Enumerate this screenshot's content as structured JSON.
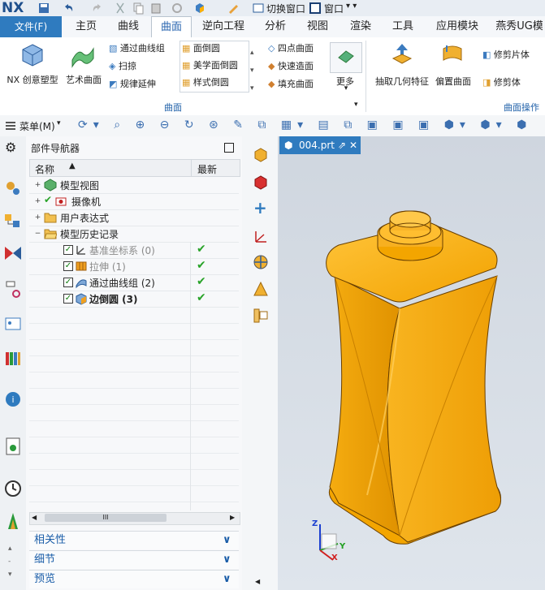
{
  "app": {
    "logo": "NX",
    "switch_window": "切换窗口",
    "window_menu": "窗口"
  },
  "menu": {
    "file": "文件(F)",
    "tabs": [
      "主页",
      "曲线",
      "曲面",
      "逆向工程",
      "分析",
      "视图",
      "渲染",
      "工具",
      "应用模块",
      "燕秀UG模"
    ],
    "active": "曲面"
  },
  "ribbon": {
    "big": [
      "NX 创意塑型",
      "艺术曲面"
    ],
    "col1": [
      "通过曲线组",
      "扫掠",
      "规律延伸"
    ],
    "col2": [
      "面倒圆",
      "美学面倒圆",
      "样式倒圆"
    ],
    "col3": [
      "四点曲面",
      "快速造面",
      "填充曲面"
    ],
    "more": "更多",
    "group1_label": "曲面",
    "extract": "抽取几何特征",
    "offset": "偏置曲面",
    "trim_sheet": "修剪片体",
    "trim_body": "修剪体",
    "group2_label": "曲面操作"
  },
  "toolbar": {
    "menu_label": "菜单(M)"
  },
  "navigator": {
    "title": "部件导航器",
    "col_name": "名称",
    "col_latest": "最新",
    "rows": [
      {
        "label": "模型视图",
        "latest": ""
      },
      {
        "label": "摄像机",
        "latest": ""
      },
      {
        "label": "用户表达式",
        "latest": ""
      },
      {
        "label": "模型历史记录",
        "latest": ""
      },
      {
        "label": "基准坐标系 (0)",
        "latest": "✔"
      },
      {
        "label": "拉伸 (1)",
        "latest": "✔"
      },
      {
        "label": "通过曲线组 (2)",
        "latest": "✔"
      },
      {
        "label": "边倒圆 (3)",
        "latest": "✔"
      }
    ],
    "scroll_mark": "III",
    "panels": [
      "相关性",
      "细节",
      "预览"
    ]
  },
  "graphics": {
    "file_tab": "004.prt",
    "triad": {
      "z": "Z",
      "y": "Y",
      "x": "X"
    }
  },
  "colors": {
    "accent": "#2f7bbf",
    "part": "#f5a400",
    "check": "#29a329"
  }
}
